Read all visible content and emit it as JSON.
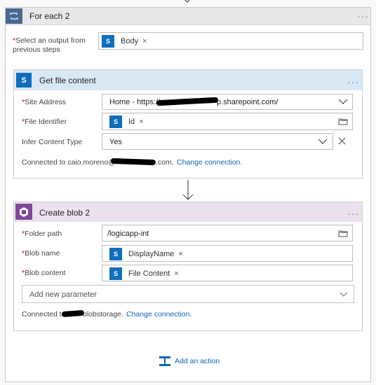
{
  "foreach": {
    "title": "For each 2",
    "select_label_line1": "Select an output from",
    "select_label_line2": "previous steps",
    "token": "Body",
    "token_remove": "×",
    "more": "···"
  },
  "get_file": {
    "title": "Get file content",
    "more": "···",
    "site_address_label": "Site Address",
    "site_address_value_prefix": "Home - https://",
    "site_address_value_suffix": "p.sharepoint.com/",
    "file_identifier_label": "File Identifier",
    "file_identifier_token": "Id",
    "infer_label": "Infer Content Type",
    "infer_value": "Yes",
    "connected_prefix": "Connected to caio.moreno@",
    "connected_suffix": ".com.",
    "change_connection": "Change connection."
  },
  "create_blob": {
    "title": "Create blob 2",
    "more": "···",
    "folder_label": "Folder path",
    "folder_value": "/logicapp-int",
    "blob_name_label": "Blob name",
    "blob_name_token": "DisplayName",
    "blob_content_label": "Blob content",
    "blob_content_token": "File Content",
    "add_param": "Add new parameter",
    "connected_prefix": "Connected to",
    "connected_suffix": "blobstorage.",
    "change_connection": "Change connection."
  },
  "add_action": {
    "label": "Add an action"
  },
  "required_mark": "*",
  "remove_mark": "×",
  "colors": {
    "accent": "#0b63b6",
    "sharepoint": "#0f6fbd",
    "foreach": "#486991",
    "blob": "#804998"
  }
}
